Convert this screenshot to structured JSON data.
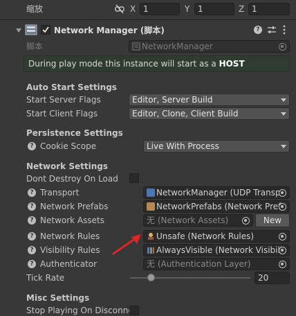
{
  "scale_row": {
    "label": "缩放",
    "x_label": "X",
    "x_value": "1",
    "y_label": "Y",
    "y_value": "1",
    "z_label": "Z",
    "z_value": "1"
  },
  "component": {
    "title": "Network Manager (脚本)",
    "enabled": true,
    "script_label": "脚本",
    "script_value": "NetworkManager"
  },
  "info_banner": {
    "text": "During play mode this instance will start as a ",
    "mode": "HOST"
  },
  "auto_start": {
    "header": "Auto Start Settings",
    "server_label": "Start Server Flags",
    "server_value": "Editor, Server Build",
    "client_label": "Start Client Flags",
    "client_value": "Editor, Clone, Client Build"
  },
  "persistence": {
    "header": "Persistence Settings",
    "cookie_label": "Cookie Scope",
    "cookie_value": "Live With Process"
  },
  "network": {
    "header": "Network Settings",
    "dont_destroy_label": "Dont Destroy On Load",
    "transport_label": "Transport",
    "transport_value": "NetworkManager (UDP Transpo",
    "prefabs_label": "Network Prefabs",
    "prefabs_value": "NetworkPrefabs (Network Prefa",
    "assets_label": "Network Assets",
    "assets_value": "无 (Network Assets)",
    "new_button": "New",
    "rules_label": "Network Rules",
    "rules_value": "Unsafe (Network Rules)",
    "visibility_label": "Visibility Rules",
    "visibility_value": "AlwaysVisible (Network Visibilit",
    "auth_label": "Authenticator",
    "auth_value": "无 (Authentication Layer)",
    "tick_label": "Tick Rate",
    "tick_value": "20",
    "tick_fraction": 0.17
  },
  "misc": {
    "header": "Misc Settings",
    "stop_label": "Stop Playing On Disconne"
  },
  "colors": {
    "background": "#383838",
    "banner_bg": "#2f3c2f",
    "arrow": "#e02424"
  },
  "icons": {
    "scale_link": "unlink-icon",
    "component": "network-component-icon",
    "help": "question-icon",
    "presets": "sliders-icon",
    "menu": "kebab-menu-icon",
    "picker": "object-picker-icon"
  }
}
